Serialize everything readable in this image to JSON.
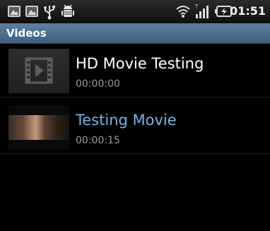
{
  "status_bar": {
    "time": "01:51",
    "icons": [
      "gallery-icon",
      "gallery-icon",
      "usb-icon",
      "android-debug-icon",
      "wifi-icon",
      "signal-icon",
      "battery-charging-icon"
    ]
  },
  "header": {
    "title": "Videos"
  },
  "videos": [
    {
      "title": "HD Movie Testing",
      "duration": "00:00:00",
      "thumbnail": "video-placeholder-icon",
      "selected": false
    },
    {
      "title": "Testing Movie",
      "duration": "00:00:15",
      "thumbnail": "video-thumbnail",
      "selected": true
    }
  ],
  "colors": {
    "title_bar": "#4e6e8f",
    "selected_text": "#7ab3e8",
    "secondary_text": "#9a9a9a"
  }
}
